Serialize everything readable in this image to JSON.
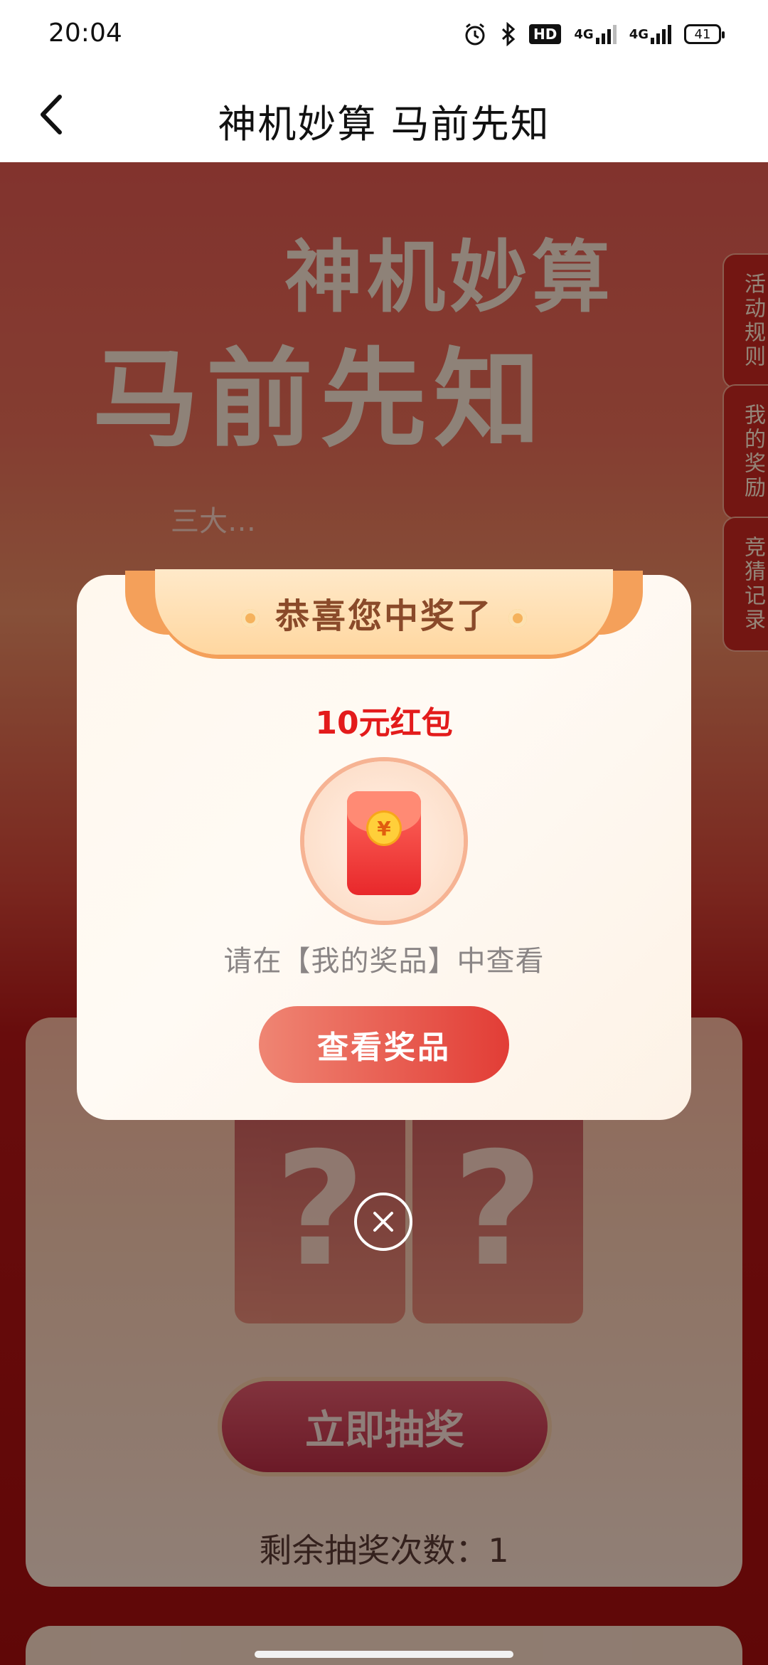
{
  "status_bar": {
    "time": "20:04",
    "hd_label": "HD",
    "net_1": "4G",
    "net_2": "4G",
    "battery": "41",
    "icons": [
      "alarm-icon",
      "bluetooth-icon",
      "hd-icon",
      "signal-icon",
      "signal-icon",
      "battery-icon"
    ]
  },
  "nav": {
    "title": "神机妙算  马前先知",
    "back_icon": "chevron-left-icon"
  },
  "hero": {
    "title_line_1": "神机妙算",
    "title_line_2": "马前先知",
    "subtitle": "三大…"
  },
  "side_tabs": {
    "rules": "活动规则",
    "prizes": "我的奖励",
    "records": "竞猜记录"
  },
  "draw_panel": {
    "card_mark": "?",
    "draw_button": "立即抽奖",
    "remaining_label": "剩余抽奖次数：1"
  },
  "dialog": {
    "title": "恭喜您中奖了",
    "prize_name": "10元红包",
    "prize_icon": "red-packet-icon",
    "coin_symbol": "¥",
    "hint": "请在【我的奖品】中查看",
    "view_button": "查看奖品",
    "close_icon": "close-icon"
  },
  "colors": {
    "accent_red": "#e31b1b",
    "button_gradient_start": "#ef8573",
    "button_gradient_end": "#e23d36",
    "page_red": "#b31616"
  }
}
